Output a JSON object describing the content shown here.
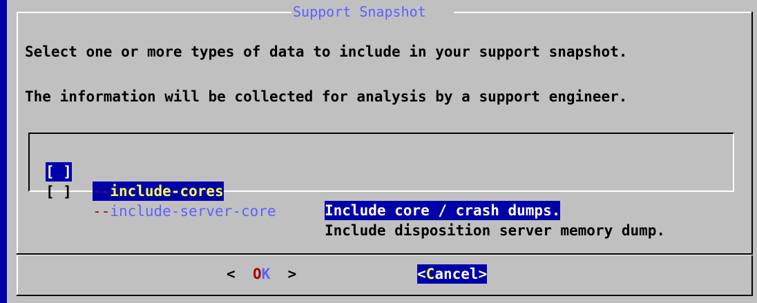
{
  "dialog": {
    "title": "Support Snapshot",
    "lines": [
      "Select one or more types of data to include in your support snapshot.",
      "The information will be collected for analysis by a support engineer."
    ]
  },
  "options": [
    {
      "checkbox": "[ ]",
      "dash": "--",
      "name": "include-cores",
      "description": "Include core / crash dumps.",
      "selected": true,
      "checked": false
    },
    {
      "checkbox": "[ ]",
      "dash": "--",
      "name": "include-server-core",
      "description": "Include disposition server memory dump.",
      "selected": false,
      "checked": false
    }
  ],
  "buttons": {
    "ok": {
      "left_bracket": "<",
      "hotkey": "O",
      "rest": "K",
      "right_bracket": ">"
    },
    "cancel": {
      "left_bracket": "<",
      "hotkey": "C",
      "rest": "ancel",
      "right_bracket": ">"
    }
  },
  "colors": {
    "background": "#0000a8",
    "dialog": "#c0c0c0",
    "title": "#5f5fff",
    "highlight": "#0000a8",
    "hotkey_selected": "#ffff54",
    "hotkey": "#a80000"
  }
}
